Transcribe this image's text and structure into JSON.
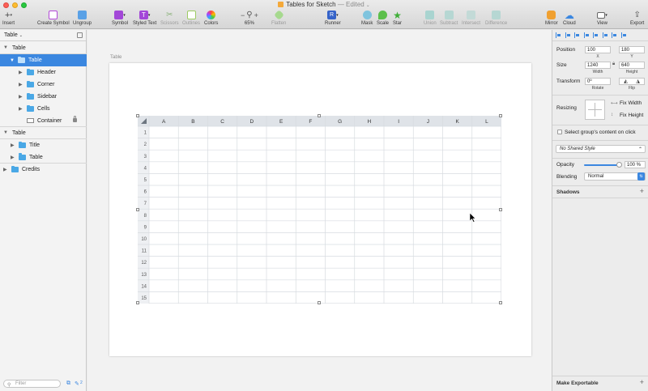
{
  "window": {
    "title": "Tables for Sketch",
    "status": "— Edited"
  },
  "toolbar": {
    "insert": "Insert",
    "create_symbol": "Create Symbol",
    "ungroup": "Ungroup",
    "symbol": "Symbol",
    "styled_text": "Styled Text",
    "scissors": "Scissors",
    "outlines": "Outlines",
    "colors": "Colors",
    "zoom": "65%",
    "flatten": "Flatten",
    "runner": "Runner",
    "mask": "Mask",
    "scale": "Scale",
    "star": "Star",
    "union": "Union",
    "subtract": "Subtract",
    "intersect": "Intersect",
    "difference": "Difference",
    "mirror": "Mirror",
    "cloud": "Cloud",
    "view": "View",
    "export": "Export"
  },
  "layers": {
    "page_name": "Table",
    "items": [
      {
        "label": "Table"
      },
      {
        "label": "Table"
      },
      {
        "label": "Header"
      },
      {
        "label": "Corner"
      },
      {
        "label": "Sidebar"
      },
      {
        "label": "Cells"
      },
      {
        "label": "Container"
      },
      {
        "label": "Table"
      },
      {
        "label": "Title"
      },
      {
        "label": "Table"
      },
      {
        "label": "Credits"
      }
    ],
    "filter_placeholder": "Filter",
    "footer_count": "2"
  },
  "canvas": {
    "artboard_label": "Table",
    "columns": [
      "A",
      "B",
      "C",
      "D",
      "E",
      "F",
      "G",
      "H",
      "I",
      "J",
      "K",
      "L"
    ],
    "rows": [
      "1",
      "2",
      "3",
      "4",
      "5",
      "6",
      "7",
      "8",
      "9",
      "10",
      "11",
      "12",
      "13",
      "14",
      "15"
    ]
  },
  "inspector": {
    "position_label": "Position",
    "x_value": "100",
    "y_value": "180",
    "x_label": "X",
    "y_label": "Y",
    "size_label": "Size",
    "width_value": "1240",
    "height_value": "640",
    "width_label": "Width",
    "height_label": "Height",
    "transform_label": "Transform",
    "rotate_value": "0º",
    "rotate_label": "Rotate",
    "flip_label": "Flip",
    "resizing_label": "Resizing",
    "fix_width": "Fix Width",
    "fix_height": "Fix Height",
    "select_group_content": "Select group's content on click",
    "shared_style": "No Shared Style",
    "opacity_label": "Opacity",
    "opacity_value": "100 %",
    "opacity_fraction": 1.0,
    "blending_label": "Blending",
    "blending_value": "Normal",
    "shadows_label": "Shadows",
    "make_exportable": "Make Exportable"
  },
  "colors": {
    "selection": "#3b87e0",
    "folder": "#4aa8e6",
    "header_fill": "#dfe3e8",
    "grid_line": "#d7dbe0"
  }
}
